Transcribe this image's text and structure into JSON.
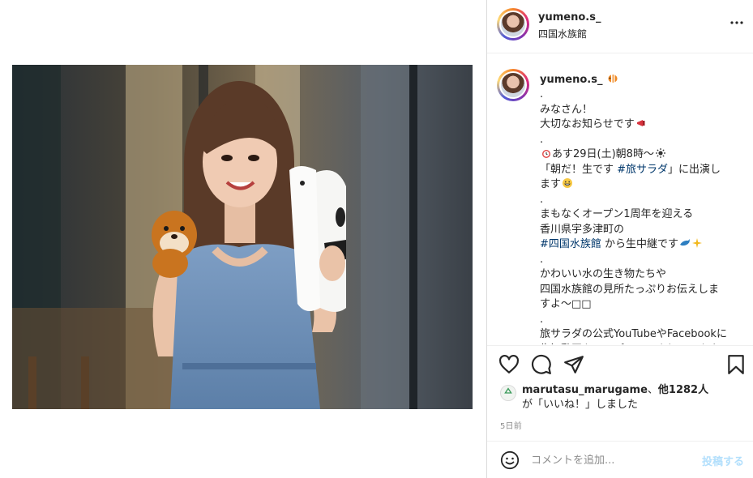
{
  "post": {
    "username": "yumeno.s_",
    "location": "四国水族館",
    "photo_alt": ""
  },
  "caption": {
    "username": "yumeno.s_",
    "lines": [
      [
        {
          "t": "."
        }
      ],
      [
        {
          "t": "みなさん！"
        }
      ],
      [
        {
          "t": "大切なお知らせです"
        },
        {
          "emoji": "megaphone-emoji"
        }
      ],
      [
        {
          "t": "."
        }
      ],
      [
        {
          "emoji": "alarm-clock-emoji"
        },
        {
          "t": "あす29日(土)朝8時〜"
        },
        {
          "emoji": "sun-emoji"
        }
      ],
      [
        {
          "t": "「朝だ！生です "
        },
        {
          "tag": "#旅サラダ"
        },
        {
          "t": "」に出演し"
        }
      ],
      [
        {
          "t": "ます"
        },
        {
          "emoji": "grin-emoji"
        }
      ],
      [
        {
          "t": "."
        }
      ],
      [
        {
          "t": "まもなくオープン1周年を迎える"
        }
      ],
      [
        {
          "t": "香川県宇多津町の"
        }
      ],
      [
        {
          "tag": "#四国水族館"
        },
        {
          "t": " から生中継です"
        },
        {
          "emoji": "dolphin-emoji"
        },
        {
          "emoji": "sparkles-emoji"
        }
      ],
      [
        {
          "t": "."
        }
      ],
      [
        {
          "t": "かわいい水の生き物たちや"
        }
      ],
      [
        {
          "t": "四国水族館の見所たっぷりお伝えしま"
        }
      ],
      [
        {
          "t": "すよ〜□□"
        }
      ],
      [
        {
          "t": "."
        }
      ],
      [
        {
          "t": "旅サラダの公式YouTubeやFacebookに"
        }
      ],
      [
        {
          "t": "告知動画をアップロードされています"
        }
      ]
    ]
  },
  "likes": {
    "user": "marutasu_marugame",
    "sep": "、",
    "others": "他1282人",
    "suffix": "が「いいね！」しました"
  },
  "timestamp": "5日前",
  "comment": {
    "placeholder": "コメントを追加...",
    "post_label": "投稿する",
    "post_color": "#b2dffc"
  },
  "icons": {
    "more": "more-dots-icon",
    "like": "heart-icon",
    "comment": "comment-bubble-icon",
    "share": "paper-plane-icon",
    "save": "bookmark-icon",
    "emoji": "smiley-icon"
  },
  "colors": {
    "hashtag": "#00376b",
    "border": "#dbdbdb",
    "muted": "#8e8e8e"
  }
}
